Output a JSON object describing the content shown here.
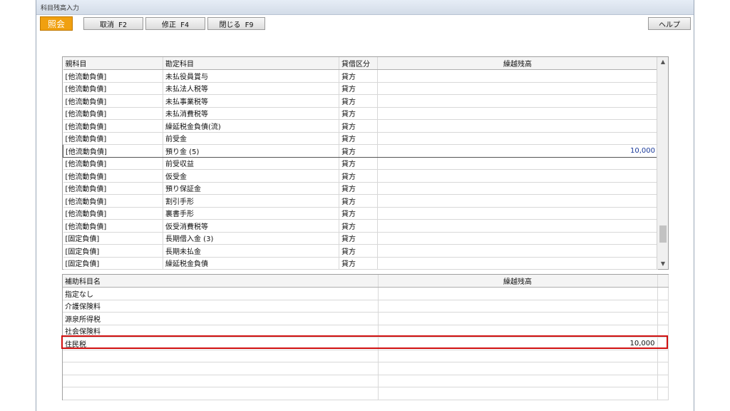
{
  "window": {
    "title": "科目残高入力"
  },
  "toolbar": {
    "shokai": "照会",
    "cancel": "取消 F2",
    "modify": "修正 F4",
    "close": "閉じる F9",
    "help": "ヘルプ"
  },
  "upper": {
    "headers": [
      "親科目",
      "勘定科目",
      "貸借区分",
      "繰越残高"
    ],
    "rows": [
      [
        "[他流動負債]",
        "未払役員賞与",
        "貸方",
        ""
      ],
      [
        "[他流動負債]",
        "未払法人税等",
        "貸方",
        ""
      ],
      [
        "[他流動負債]",
        "未払事業税等",
        "貸方",
        ""
      ],
      [
        "[他流動負債]",
        "未払消費税等",
        "貸方",
        ""
      ],
      [
        "[他流動負債]",
        "繰延税金負債(流)",
        "貸方",
        ""
      ],
      [
        "[他流動負債]",
        "前受金",
        "貸方",
        ""
      ],
      [
        "[他流動負債]",
        "預り金 (5)",
        "貸方",
        "10,000"
      ],
      [
        "[他流動負債]",
        "前受収益",
        "貸方",
        ""
      ],
      [
        "[他流動負債]",
        "仮受金",
        "貸方",
        ""
      ],
      [
        "[他流動負債]",
        "預り保証金",
        "貸方",
        ""
      ],
      [
        "[他流動負債]",
        "割引手形",
        "貸方",
        ""
      ],
      [
        "[他流動負債]",
        "裏書手形",
        "貸方",
        ""
      ],
      [
        "[他流動負債]",
        "仮受消費税等",
        "貸方",
        ""
      ],
      [
        "[固定負債]",
        "長期借入金 (3)",
        "貸方",
        ""
      ],
      [
        "[固定負債]",
        "長期未払金",
        "貸方",
        ""
      ],
      [
        "[固定負債]",
        "繰延税金負債",
        "貸方",
        ""
      ]
    ],
    "selected_index": 6
  },
  "lower": {
    "headers": [
      "補助科目名",
      "繰越残高"
    ],
    "rows": [
      [
        "指定なし",
        ""
      ],
      [
        "介護保険料",
        ""
      ],
      [
        "源泉所得税",
        ""
      ],
      [
        "社会保険料",
        ""
      ],
      [
        "住民税",
        "10,000"
      ],
      [
        "",
        ""
      ],
      [
        "",
        ""
      ],
      [
        "",
        ""
      ],
      [
        "",
        ""
      ]
    ],
    "highlighted_index": 4
  },
  "colors": {
    "accent": "#f0a010",
    "highlight": "#d01010",
    "value_blue": "#1a3a9a"
  }
}
